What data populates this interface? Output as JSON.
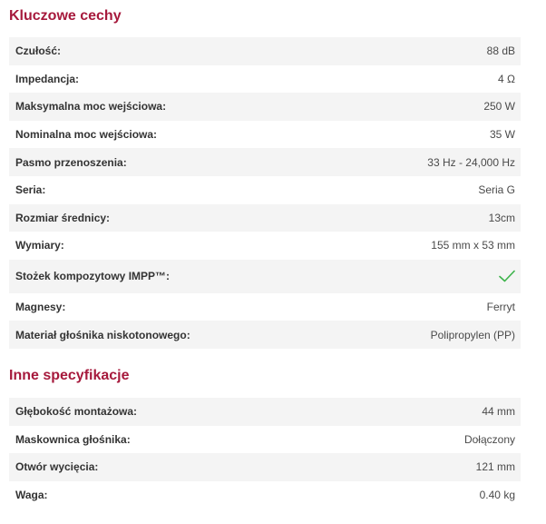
{
  "sections": [
    {
      "title": "Kluczowe cechy",
      "rows": [
        {
          "label": "Czułość:",
          "value": "88 dB"
        },
        {
          "label": "Impedancja:",
          "value": "4 Ω"
        },
        {
          "label": "Maksymalna moc wejściowa:",
          "value": "250 W"
        },
        {
          "label": "Nominalna moc wejściowa:",
          "value": "35 W"
        },
        {
          "label": "Pasmo przenoszenia:",
          "value": "33 Hz - 24,000 Hz"
        },
        {
          "label": "Seria:",
          "value": "Seria G"
        },
        {
          "label": "Rozmiar średnicy:",
          "value": "13cm"
        },
        {
          "label": "Wymiary:",
          "value": "155 mm x 53 mm"
        },
        {
          "label": "Stożek kompozytowy IMPP™:",
          "value": "",
          "icon": "check-icon"
        },
        {
          "label": "Magnesy:",
          "value": "Ferryt"
        },
        {
          "label": "Materiał głośnika niskotonowego:",
          "value": "Polipropylen (PP)"
        }
      ]
    },
    {
      "title": "Inne specyfikacje",
      "rows": [
        {
          "label": "Głębokość montażowa:",
          "value": "44 mm"
        },
        {
          "label": "Maskownica głośnika:",
          "value": "Dołączony"
        },
        {
          "label": "Otwór wycięcia:",
          "value": "121 mm"
        },
        {
          "label": "Waga:",
          "value": "0.40 kg"
        }
      ]
    }
  ],
  "colors": {
    "title": "#a6193c",
    "check": "#3cb34a",
    "stripe": "#f4f4f4"
  }
}
